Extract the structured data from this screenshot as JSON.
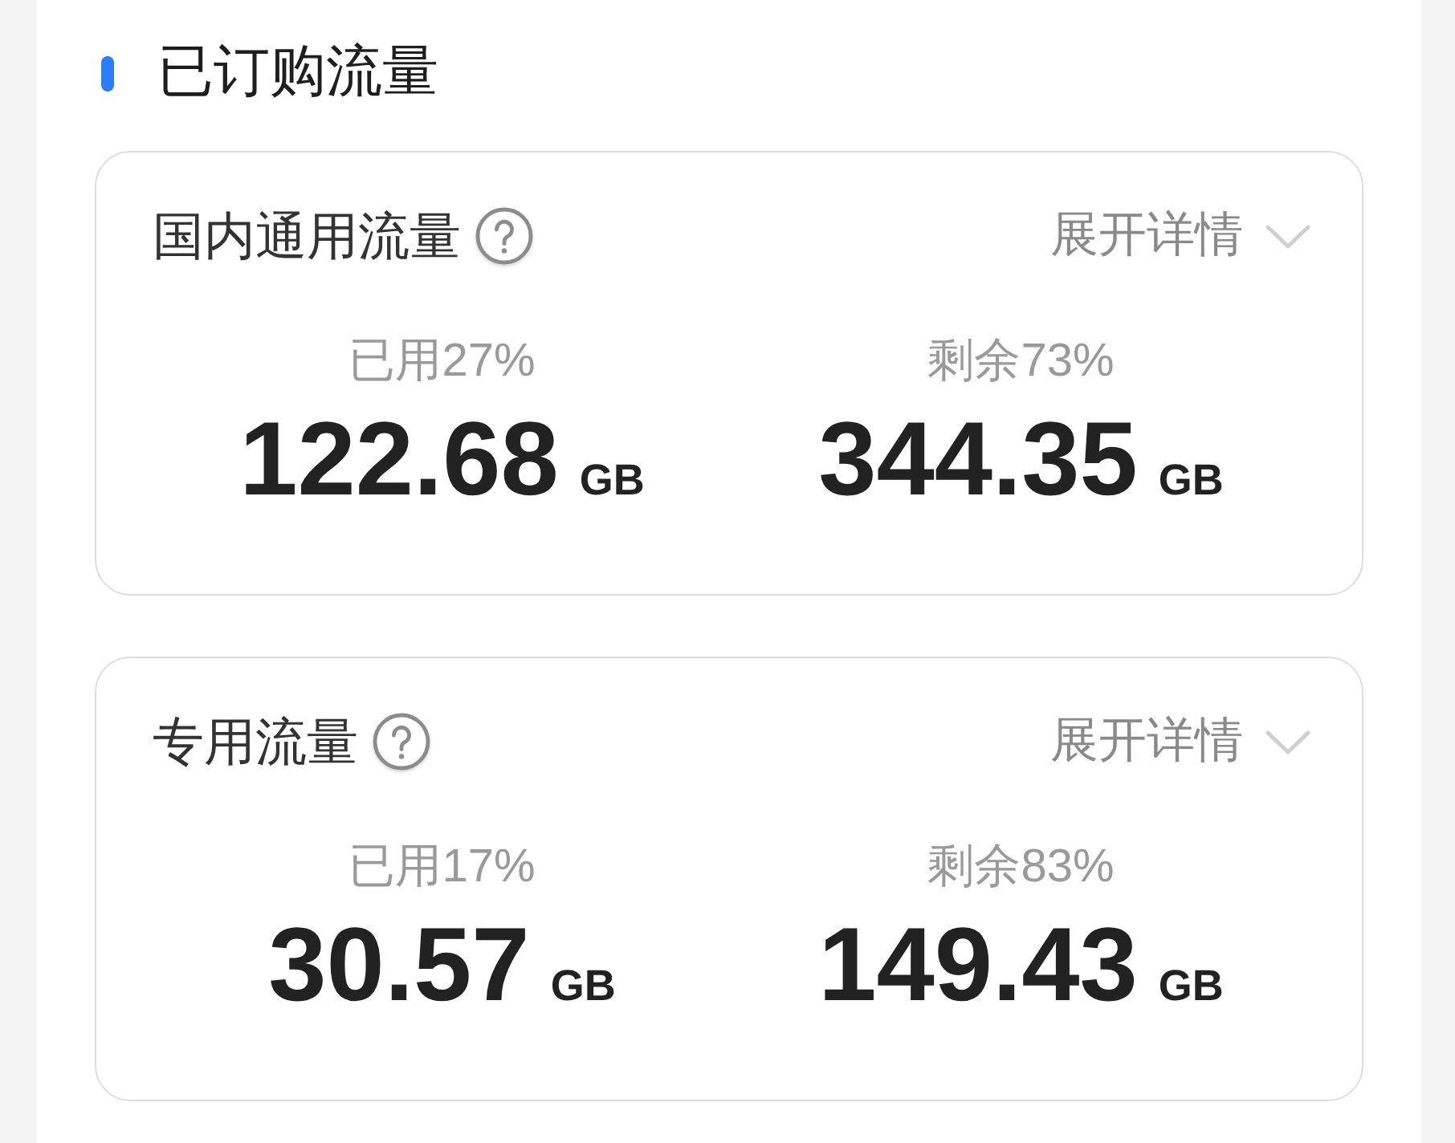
{
  "section": {
    "title": "已订购流量"
  },
  "cards": [
    {
      "title": "国内通用流量",
      "expand_label": "展开详情",
      "expanded": false,
      "stats": [
        {
          "label": "已用27%",
          "value": "122.68",
          "unit": "GB"
        },
        {
          "label": "剩余73%",
          "value": "344.35",
          "unit": "GB"
        }
      ]
    },
    {
      "title": "专用流量",
      "expand_label": "展开详情",
      "expanded": false,
      "stats": [
        {
          "label": "已用17%",
          "value": "30.57",
          "unit": "GB"
        },
        {
          "label": "剩余83%",
          "value": "149.43",
          "unit": "GB"
        }
      ]
    }
  ]
}
